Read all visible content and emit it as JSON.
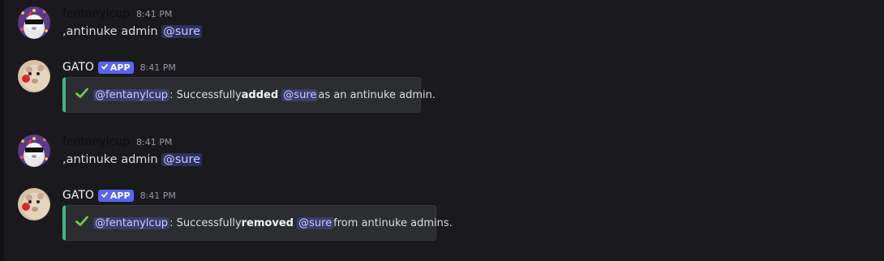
{
  "messages": [
    {
      "author": "fentanylcup",
      "time": "8:41 PM",
      "text_pre": ",antinuke admin ",
      "mention": "@sure"
    },
    {
      "author": "GATO",
      "badge": "APP",
      "time": "8:41 PM",
      "embed": {
        "mention_user": "@fentanylcup",
        "text_a": ": Successfully ",
        "action": "added",
        "mention_target": "@sure",
        "text_b": " as an antinuke admin.",
        "accent_color": "#43b581"
      }
    },
    {
      "author": "fentanylcup",
      "time": "8:41 PM",
      "text_pre": ",antinuke admin ",
      "mention": "@sure"
    },
    {
      "author": "GATO",
      "badge": "APP",
      "time": "8:41 PM",
      "embed": {
        "mention_user": "@fentanylcup",
        "text_a": ": Successfully ",
        "action": "removed",
        "mention_target": "@sure",
        "text_b": " from antinuke admins.",
        "accent_color": "#43b581"
      }
    }
  ],
  "icons": {
    "success": "checkmark-icon",
    "badge_verified": "verified-check-icon"
  }
}
